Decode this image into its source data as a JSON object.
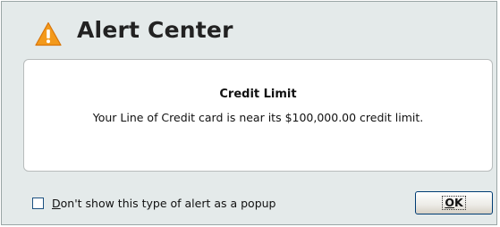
{
  "header": {
    "title": "Alert Center",
    "icon": "warning-icon"
  },
  "alert": {
    "title": "Credit Limit",
    "message": "Your Line of Credit card is near its $100,000.00 credit limit."
  },
  "footer": {
    "checkbox_mnemonic": "D",
    "checkbox_rest": "on't show this type of alert as a popup",
    "checkbox_checked": false,
    "ok_mnemonic": "O",
    "ok_rest": "K"
  },
  "colors": {
    "background": "#e4eaea",
    "warning_orange": "#f39a1c",
    "button_border": "#003c74"
  }
}
